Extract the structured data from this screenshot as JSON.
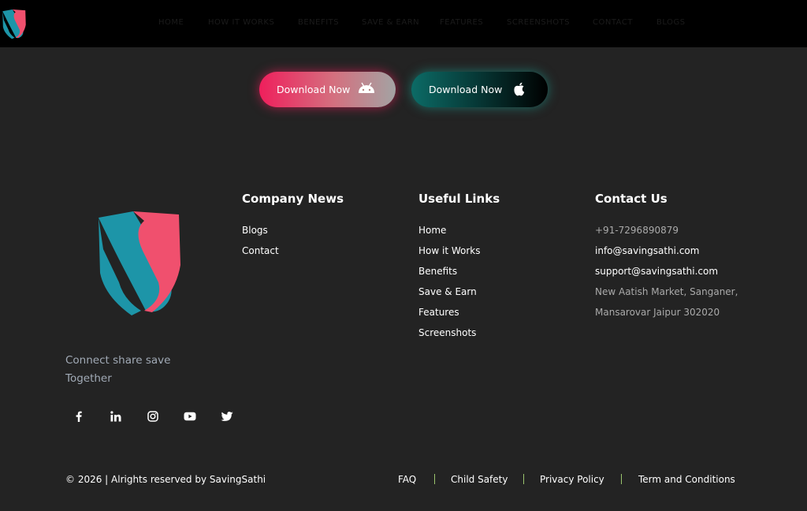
{
  "nav": {
    "items": [
      "HOME",
      "HOW IT WORKS",
      "BENEFITS",
      "SAVE & EARN",
      "FEATURES",
      "SCREENSHOTS",
      "CONTACT",
      "BLOGS"
    ]
  },
  "download": {
    "android_label": "Download Now",
    "apple_label": "Download Now"
  },
  "about": {
    "tagline_line1": "Connect share save",
    "tagline_line2": "Together",
    "social_icons": [
      "facebook-icon",
      "linkedin-icon",
      "instagram-icon",
      "youtube-icon",
      "twitter-icon"
    ]
  },
  "company_news": {
    "title": "Company News",
    "links": [
      "Blogs",
      "Contact"
    ]
  },
  "useful_links": {
    "title": "Useful Links",
    "links": [
      "Home",
      "How it Works",
      "Benefits",
      "Save & Earn",
      "Features",
      "Screenshots"
    ]
  },
  "contact": {
    "title": "Contact Us",
    "phone": "+91-7296890879",
    "email_info": "info@savingsathi.com",
    "email_support": "support@savingsathi.com",
    "address_line1": "New Aatish Market, Sanganer,",
    "address_line2": "Mansarovar Jaipur 302020"
  },
  "footer": {
    "copyright": "© 2026 | Alrights reserved by SavingSathi",
    "links": [
      "FAQ",
      "Child Safety",
      "Privacy Policy",
      "Term and Conditions"
    ]
  },
  "colors": {
    "brand_teal": "#1d95a8",
    "brand_pink": "#f0506e",
    "separator": "#9bc56e",
    "background": "#232323"
  }
}
